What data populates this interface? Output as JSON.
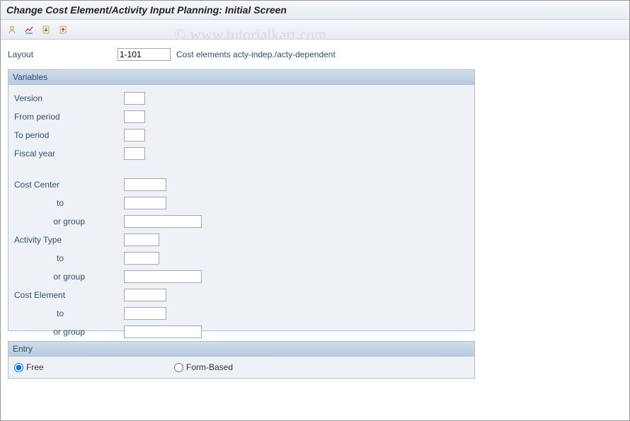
{
  "title": "Change Cost Element/Activity Input Planning: Initial Screen",
  "watermark": "© www.tutorialkart.com",
  "toolbar": {
    "icons": [
      "user-icon",
      "overview-icon",
      "import-icon",
      "export-icon"
    ]
  },
  "layout": {
    "label": "Layout",
    "value": "1-101",
    "desc": "Cost elements acty-indep./acty-dependent"
  },
  "variables": {
    "title": "Variables",
    "fields": {
      "version_label": "Version",
      "from_period_label": "From period",
      "to_period_label": "To period",
      "fiscal_year_label": "Fiscal year",
      "cost_center_label": "Cost Center",
      "to_label": "to",
      "or_group_label": "or group",
      "activity_type_label": "Activity Type",
      "cost_element_label": "Cost Element"
    }
  },
  "entry": {
    "title": "Entry",
    "free_label": "Free",
    "form_label": "Form-Based",
    "selected": "free"
  }
}
